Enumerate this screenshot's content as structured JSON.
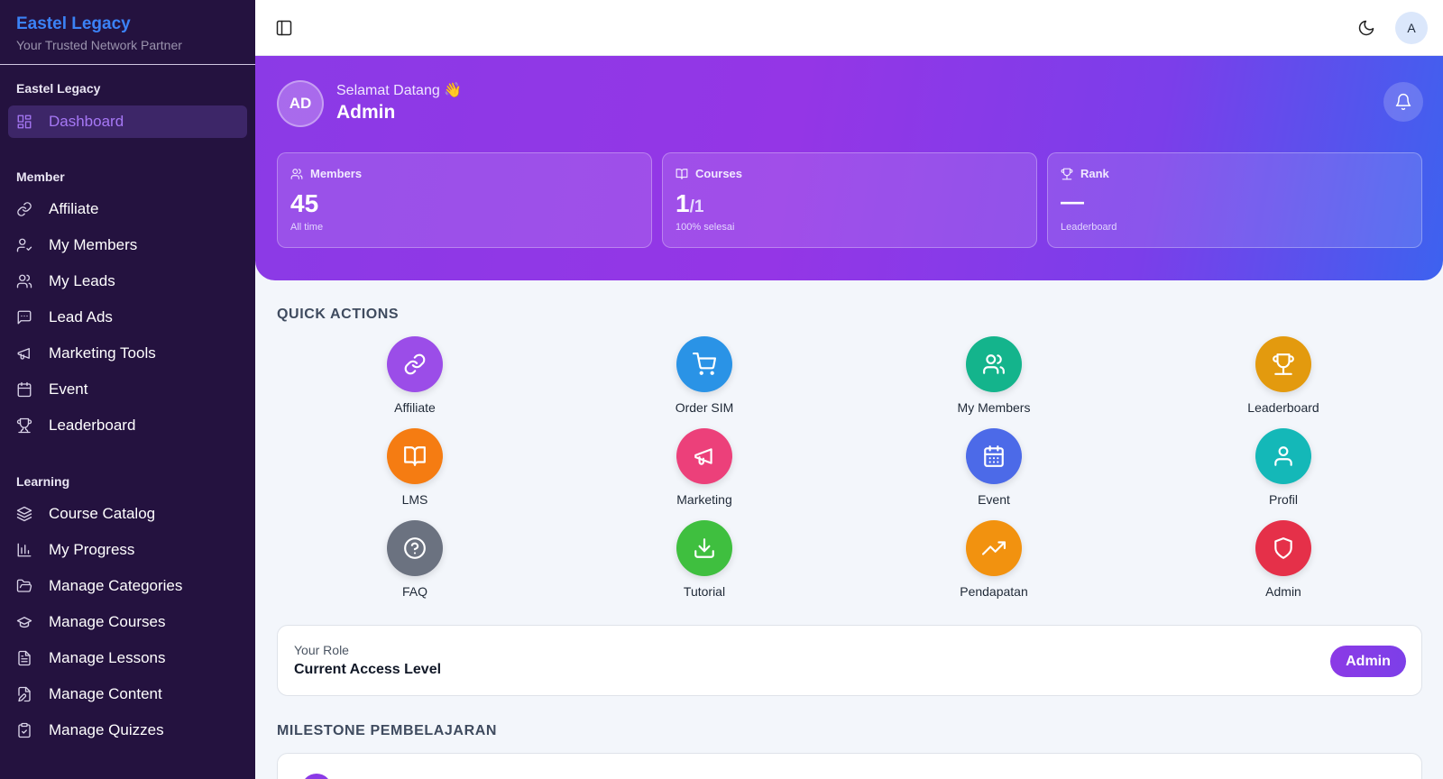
{
  "brand": {
    "title": "Eastel Legacy",
    "subtitle": "Your Trusted Network Partner"
  },
  "sidebar": {
    "groups": [
      {
        "label": "Eastel Legacy"
      },
      {
        "label": "Member"
      },
      {
        "label": "Learning"
      }
    ],
    "items": [
      {
        "label": "Dashboard",
        "icon": "grid-icon",
        "active": true
      },
      {
        "label": "Affiliate",
        "icon": "link-icon"
      },
      {
        "label": "My Members",
        "icon": "user-check-icon"
      },
      {
        "label": "My Leads",
        "icon": "users-icon"
      },
      {
        "label": "Lead Ads",
        "icon": "message-square-icon"
      },
      {
        "label": "Marketing Tools",
        "icon": "megaphone-icon"
      },
      {
        "label": "Event",
        "icon": "calendar-icon"
      },
      {
        "label": "Leaderboard",
        "icon": "trophy-icon"
      },
      {
        "label": "Course Catalog",
        "icon": "layers-icon"
      },
      {
        "label": "My Progress",
        "icon": "bar-chart-icon"
      },
      {
        "label": "Manage Categories",
        "icon": "folder-open-icon"
      },
      {
        "label": "Manage Courses",
        "icon": "graduation-cap-icon"
      },
      {
        "label": "Manage Lessons",
        "icon": "file-text-icon"
      },
      {
        "label": "Manage Content",
        "icon": "file-edit-icon"
      },
      {
        "label": "Manage Quizzes",
        "icon": "clipboard-check-icon"
      }
    ]
  },
  "topbar": {
    "avatar_initial": "A"
  },
  "hero": {
    "avatar_initials": "AD",
    "greeting": "Selamat Datang 👋",
    "name": "Admin",
    "stats": {
      "members": {
        "label": "Members",
        "value": "45",
        "footnote": "All time"
      },
      "courses": {
        "label": "Courses",
        "value": "1",
        "value_sub": "/1",
        "footnote": "100% selesai"
      },
      "rank": {
        "label": "Rank",
        "value": "—",
        "footnote": "Leaderboard"
      }
    }
  },
  "quick_actions": {
    "title": "QUICK ACTIONS",
    "items": [
      {
        "label": "Affiliate",
        "icon": "link-icon",
        "color": "#9b4de8"
      },
      {
        "label": "Order SIM",
        "icon": "cart-icon",
        "color": "#2a93e6"
      },
      {
        "label": "My Members",
        "icon": "users-icon",
        "color": "#14b48c"
      },
      {
        "label": "Leaderboard",
        "icon": "trophy-icon",
        "color": "#e39a0e"
      },
      {
        "label": "LMS",
        "icon": "book-open-icon",
        "color": "#f57c12"
      },
      {
        "label": "Marketing",
        "icon": "megaphone-icon",
        "color": "#ec407a"
      },
      {
        "label": "Event",
        "icon": "calendar-icon",
        "color": "#4c6ae8"
      },
      {
        "label": "Profil",
        "icon": "user-icon",
        "color": "#14b8b8"
      },
      {
        "label": "FAQ",
        "icon": "help-circle-icon",
        "color": "#6b7280"
      },
      {
        "label": "Tutorial",
        "icon": "download-icon",
        "color": "#3fbf3f"
      },
      {
        "label": "Pendapatan",
        "icon": "trending-up-icon",
        "color": "#f2920f"
      },
      {
        "label": "Admin",
        "icon": "shield-icon",
        "color": "#e53049"
      }
    ]
  },
  "role": {
    "label": "Your Role",
    "title": "Current Access Level",
    "badge": "Admin"
  },
  "milestone": {
    "title": "MILESTONE PEMBELAJARAN"
  }
}
